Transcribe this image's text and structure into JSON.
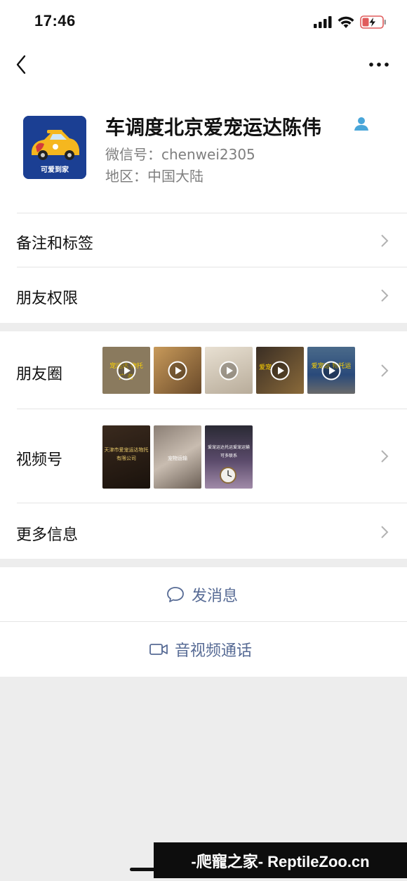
{
  "status_bar": {
    "time": "17:46"
  },
  "profile": {
    "name": "车调度北京爱宠运达陈伟",
    "wechat_id": "微信号：chenwei2305",
    "region": "地区：中国大陆",
    "avatar_caption": "可爱到家"
  },
  "rows": {
    "remark_tags": "备注和标签",
    "friend_permissions": "朋友权限",
    "moments": "朋友圈",
    "channels": "视频号",
    "more_info": "更多信息"
  },
  "moments_thumbs": [
    {
      "text": "宠运达 物托",
      "text2": "广  务",
      "color": "#8a7a5e",
      "icon": "play-icon"
    },
    {
      "text": "",
      "text2": "",
      "color": "#b28650",
      "icon": "play-icon"
    },
    {
      "text": "",
      "text2": "",
      "color": "#d8d0c4",
      "icon": "play-icon"
    },
    {
      "text": "爱宠",
      "text2": "",
      "color": "#5a4a3a",
      "icon": "play-icon"
    },
    {
      "text": "爱宠运 物托运",
      "text2": "",
      "color": "#3a5a8a",
      "icon": "play-icon"
    }
  ],
  "channels_thumbs": [
    {
      "text": "天津市爱宠运达物托",
      "text2": "有限公司",
      "color": "#2a1e16"
    },
    {
      "text": "宠物运输",
      "text2": "",
      "color": "#a09488"
    },
    {
      "text": "爱宠运达托运爱宠运输",
      "text2": "可多联系",
      "color": "#6a5a68"
    }
  ],
  "actions": {
    "send_message": "发消息",
    "call": "音视频通话"
  },
  "watermark": "-爬寵之家- ReptileZoo.cn",
  "colors": {
    "link": "#576b95",
    "background": "#ededed",
    "separator": "#e5e5e5",
    "avatar_bg": "#1b3f93"
  }
}
